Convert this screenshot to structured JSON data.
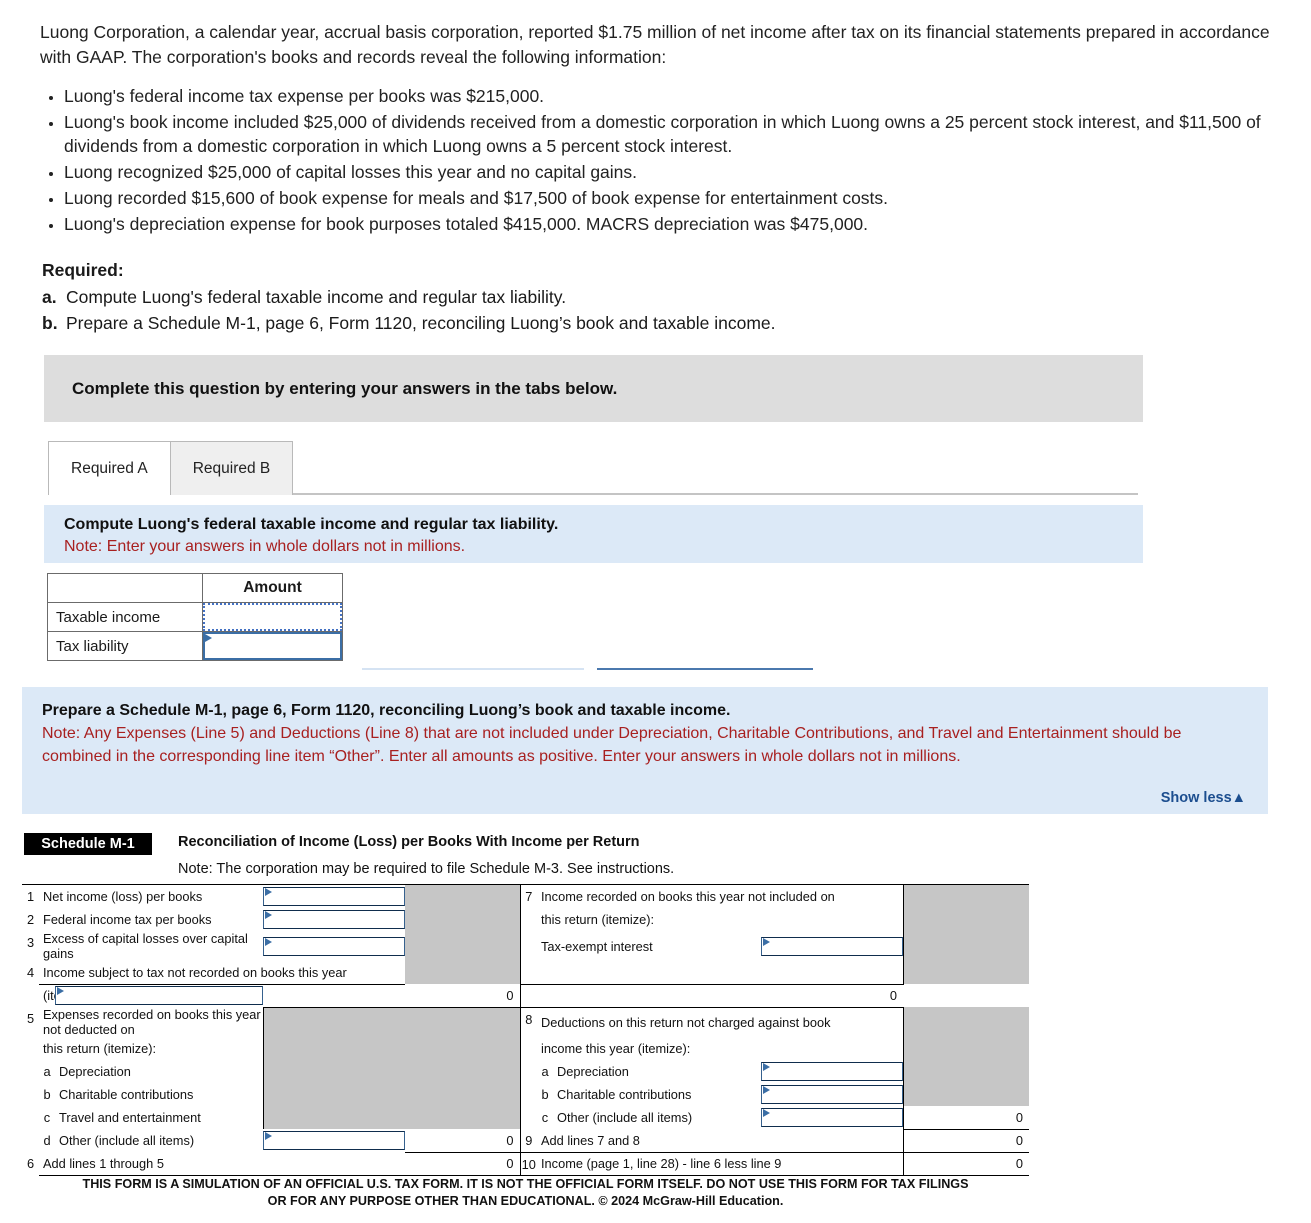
{
  "intro": {
    "paragraph": "Luong Corporation, a calendar year, accrual basis corporation, reported $1.75 million of net income after tax on its financial statements prepared in accordance with GAAP. The corporation's books and records reveal the following information:",
    "facts": [
      "Luong's federal income tax expense per books was $215,000.",
      "Luong's book income included $25,000 of dividends received from a domestic corporation in which Luong owns a 25 percent stock interest, and $11,500 of dividends from a domestic corporation in which Luong owns a 5 percent stock interest.",
      "Luong recognized $25,000 of capital losses this year and no capital gains.",
      "Luong recorded $15,600 of book expense for meals and $17,500 of book expense for entertainment costs.",
      "Luong's depreciation expense for book purposes totaled $415,000. MACRS depreciation was $475,000."
    ]
  },
  "required": {
    "heading": "Required:",
    "items": [
      {
        "label": "a.",
        "text": "Compute Luong's federal taxable income and regular tax liability."
      },
      {
        "label": "b.",
        "text": "Prepare a Schedule M-1, page 6, Form 1120, reconciling Luong’s book and taxable income."
      }
    ]
  },
  "instruction_bar": {
    "text": "Complete this question by entering your answers in the tabs below."
  },
  "tabs": [
    {
      "label": "Required A",
      "active": true
    },
    {
      "label": "Required B",
      "active": false
    }
  ],
  "panel_a": {
    "prompt": "Compute Luong's federal taxable income and regular tax liability.",
    "note": "Note: Enter your answers in whole dollars not in millions."
  },
  "amount_table": {
    "header_blank": "",
    "header_amount": "Amount",
    "rows": [
      {
        "label": "Taxable income",
        "value": ""
      },
      {
        "label": "Tax liability",
        "value": ""
      }
    ]
  },
  "panel_b": {
    "prompt": "Prepare a Schedule M-1, page 6, Form 1120, reconciling Luong’s book and taxable income.",
    "note": "Note: Any Expenses (Line 5) and Deductions (Line 8) that are not included under Depreciation, Charitable Contributions, and Travel and Entertainment should be combined in the corresponding line item “Other”. Enter all amounts as positive. Enter your answers in whole dollars not in millions.",
    "show_less": "Show less"
  },
  "schedule": {
    "badge": "Schedule M-1",
    "title": "Reconciliation of Income (Loss) per Books With Income per Return",
    "note": "Note: The corporation may be required to file Schedule M-3. See instructions.",
    "left": {
      "line1": {
        "num": "1",
        "text": "Net income (loss) per books",
        "value": ""
      },
      "line2": {
        "num": "2",
        "text": "Federal income tax per books",
        "value": ""
      },
      "line3": {
        "num": "3",
        "text": "Excess of capital losses over capital gains",
        "value": ""
      },
      "line4": {
        "num": "4",
        "text": "Income subject to tax not recorded on books this year",
        "text2": "(itemize):",
        "value": "",
        "total": "0"
      },
      "line5": {
        "num": "5",
        "text": "Expenses recorded on books this year not deducted on",
        "text2": "this return (itemize):",
        "subs": [
          {
            "letter": "a",
            "text": "Depreciation",
            "value": ""
          },
          {
            "letter": "b",
            "text": "Charitable contributions",
            "value": ""
          },
          {
            "letter": "c",
            "text": "Travel and entertainment",
            "value": ""
          },
          {
            "letter": "d",
            "text": "Other (include all items)",
            "value": "",
            "total": "0"
          }
        ]
      },
      "line6": {
        "num": "6",
        "text": "Add lines 1 through 5",
        "total": "0"
      }
    },
    "right": {
      "line7": {
        "num": "7",
        "text": "Income recorded on books this year not included on",
        "text2": "this return (itemize):",
        "text3": "Tax-exempt interest",
        "value": "",
        "total": "0"
      },
      "line8": {
        "num": "8",
        "text": "Deductions on this return not charged against book",
        "text2": "income this year (itemize):",
        "subs": [
          {
            "letter": "a",
            "text": "Depreciation",
            "value": ""
          },
          {
            "letter": "b",
            "text": "Charitable contributions",
            "value": ""
          },
          {
            "letter": "c",
            "text": "Other (include all items)",
            "value": "",
            "total": "0"
          }
        ]
      },
      "line9": {
        "num": "9",
        "text": "Add lines 7 and 8",
        "total": "0"
      },
      "line10": {
        "num": "10",
        "text": "Income (page 1, line 28) - line 6 less line 9",
        "total": "0"
      }
    }
  },
  "disclaimer": {
    "line1": "THIS FORM IS A SIMULATION OF AN OFFICIAL U.S. TAX FORM. IT IS NOT THE OFFICIAL FORM ITSELF. DO NOT USE THIS FORM FOR TAX FILINGS",
    "line2": "OR FOR ANY PURPOSE OTHER THAN EDUCATIONAL. © 2024 McGraw-Hill Education."
  },
  "colors": {
    "panel_blue": "#dce9f7",
    "header_blue": "#8fb4dd",
    "note_red": "#a82020",
    "link_blue": "#1c4e8f",
    "grey_bar": "#dddddd",
    "form_grey": "#c6c6c6"
  }
}
